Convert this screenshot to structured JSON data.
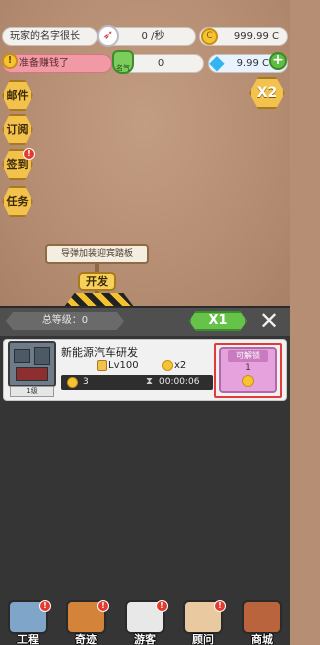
{
  "hud": {
    "player_name": "玩家的名字很长",
    "income_rate": "0 /秒",
    "coins": "999.99 C",
    "goal_text": "准备赚钱了",
    "fans_badge": "名气",
    "fans_count": "0",
    "gems": "9.99 C"
  },
  "side_menu": [
    {
      "label": "邮件",
      "badge": false
    },
    {
      "label": "订阅",
      "badge": false
    },
    {
      "label": "签到",
      "badge": true
    },
    {
      "label": "任务",
      "badge": false
    }
  ],
  "multiplier_badge": "X2",
  "scene": {
    "billboard_text": "导弹加装迎宾踏板",
    "develop_button": "开发"
  },
  "panel": {
    "total_level": "总等级：0",
    "speed_button": "X1",
    "close": "✕"
  },
  "project": {
    "title": "新能源汽车研发",
    "thumb_tag": "1级",
    "level": "Lv100",
    "multiplier": "x2",
    "coin_cost": "3",
    "duration": "00:00:06",
    "unlock_label": "可解锁",
    "unlock_cost": "1"
  },
  "nav": [
    {
      "label": "工程",
      "badge": true,
      "color": "#7fa6c8"
    },
    {
      "label": "奇迹",
      "badge": true,
      "color": "#d3843a"
    },
    {
      "label": "游客",
      "badge": true,
      "color": "#e8e8e8"
    },
    {
      "label": "顾问",
      "badge": true,
      "color": "#e9c9a0"
    },
    {
      "label": "商城",
      "badge": false,
      "color": "#b9643c"
    }
  ]
}
